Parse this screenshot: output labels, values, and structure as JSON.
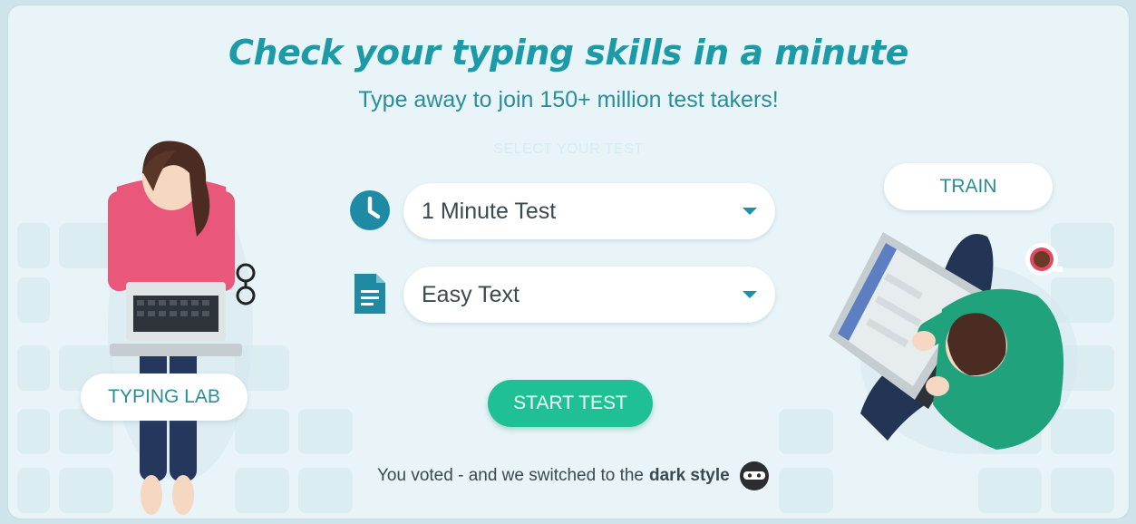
{
  "hero": {
    "title": "Check your typing skills in a minute",
    "subtitle": "Type away to join 150+ million test takers!",
    "faint_label": "SELECT YOUR TEST"
  },
  "test_duration": {
    "icon": "clock-icon",
    "value": "1 Minute Test"
  },
  "text_type": {
    "icon": "document-icon",
    "value": "Easy Text"
  },
  "start_button": "START TEST",
  "typing_lab_button": "TYPING LAB",
  "train_button": "TRAIN",
  "footer": {
    "prefix": "You voted - and we switched to the",
    "emphasis": "dark style",
    "icon": "ninja-icon"
  },
  "colors": {
    "accent": "#1d9aa8",
    "button_green": "#1fc194",
    "background": "#e8f4f8"
  }
}
